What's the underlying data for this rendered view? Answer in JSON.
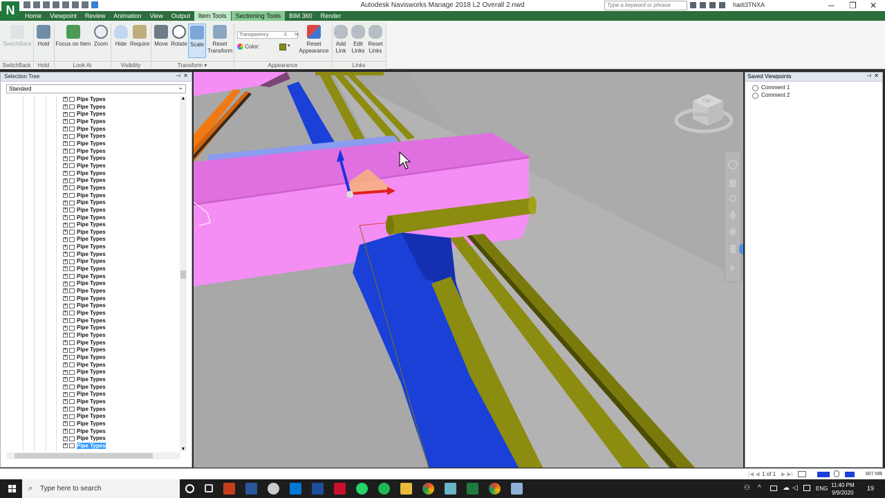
{
  "titlebar": {
    "logo": "N",
    "title": "Autodesk Navisworks Manage 2018    L2 Overall 2.nwd",
    "search_placeholder": "Type a keyword or phrase",
    "user": "hadi3TNXA",
    "min": "─",
    "max": "❐",
    "close": "✕"
  },
  "tabs": [
    {
      "label": "Home",
      "state": "normal"
    },
    {
      "label": "Viewpoint",
      "state": "normal"
    },
    {
      "label": "Review",
      "state": "normal"
    },
    {
      "label": "Animation",
      "state": "normal"
    },
    {
      "label": "View",
      "state": "normal"
    },
    {
      "label": "Output",
      "state": "normal"
    },
    {
      "label": "Item Tools",
      "state": "active"
    },
    {
      "label": "Sectioning Tools",
      "state": "ctx"
    },
    {
      "label": "BIM 360",
      "state": "normal"
    },
    {
      "label": "Render",
      "state": "normal"
    }
  ],
  "ribbon": {
    "switchback": "SwitchBack",
    "hold": "Hold",
    "focus": "Focus on Item",
    "zoom": "Zoom",
    "hide": "Hide",
    "require": "Require",
    "move": "Move",
    "rotate": "Rotate",
    "scale": "Scale",
    "reset_transform": "Reset Transform",
    "transparency_label": "Transparency",
    "transparency_value": "0",
    "transparency_unit": "%",
    "color_label": "Color:",
    "reset_appearance": "Reset Appearance",
    "add_link": "Add Link",
    "edit_links": "Edit Links",
    "reset_links": "Reset Links",
    "groups": {
      "switchback": "SwitchBack",
      "hold": "Hold",
      "lookat": "Look At",
      "visibility": "Visibility",
      "transform": "Transform",
      "appearance": "Appearance",
      "links": "Links"
    }
  },
  "selection_tree": {
    "title": "Selection Tree",
    "close": "✕",
    "dropdown_value": "Standard",
    "item_label": "Pipe Types",
    "item_count_visible": 48,
    "selected_index": 47
  },
  "saved_viewpoints": {
    "title": "Saved Viewpoints",
    "close": "✕",
    "items": [
      "Comment 1",
      "Comment 2"
    ]
  },
  "viewcube": {
    "top": "TOP",
    "front": "FRONT"
  },
  "statusbar": {
    "page": "1 of 1",
    "memory": "807 MB"
  },
  "taskbar": {
    "search_placeholder": "Type here to search",
    "language": "ENG",
    "time": "11:40 PM",
    "date": "9/9/2020",
    "notifications": "19"
  },
  "colors": {
    "ribbon_tab_bar": "#2c6e3c",
    "duct_pink": "#f48ef4",
    "pipe_blue": "#1a40d8",
    "pipe_olive": "#8c8c10",
    "pipe_orange": "#f07a14",
    "viewport_bg": "#a8a8a8"
  }
}
